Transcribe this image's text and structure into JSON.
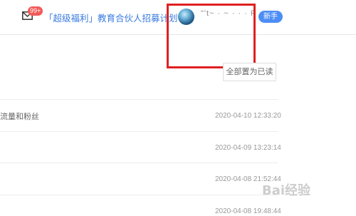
{
  "header": {
    "badge_count": "99+",
    "promo_text": "「超级福利」教育合伙人招募计划",
    "username": "\"'t~ · ~ · · · R",
    "role_badge": "新手"
  },
  "actions": {
    "mark_all_read": "全部置为已读"
  },
  "messages": [
    {
      "text": "流量和粉丝",
      "time": "2020-04-10 12:33:20"
    },
    {
      "text": "",
      "time": "2020-04-09 13:23:14"
    },
    {
      "text": "",
      "time": "2020-04-08 21:52:44"
    },
    {
      "text": "",
      "time": "2020-04-08 19:48:44"
    }
  ],
  "watermark": {
    "text": "Bai经验"
  },
  "colors": {
    "link_blue": "#3a7be0",
    "badge_red": "#f25a5a",
    "role_blue": "#4d8ef5",
    "highlight_red": "#e02020"
  },
  "icons": {
    "mail": "mail-icon",
    "avatar": "user-avatar"
  }
}
